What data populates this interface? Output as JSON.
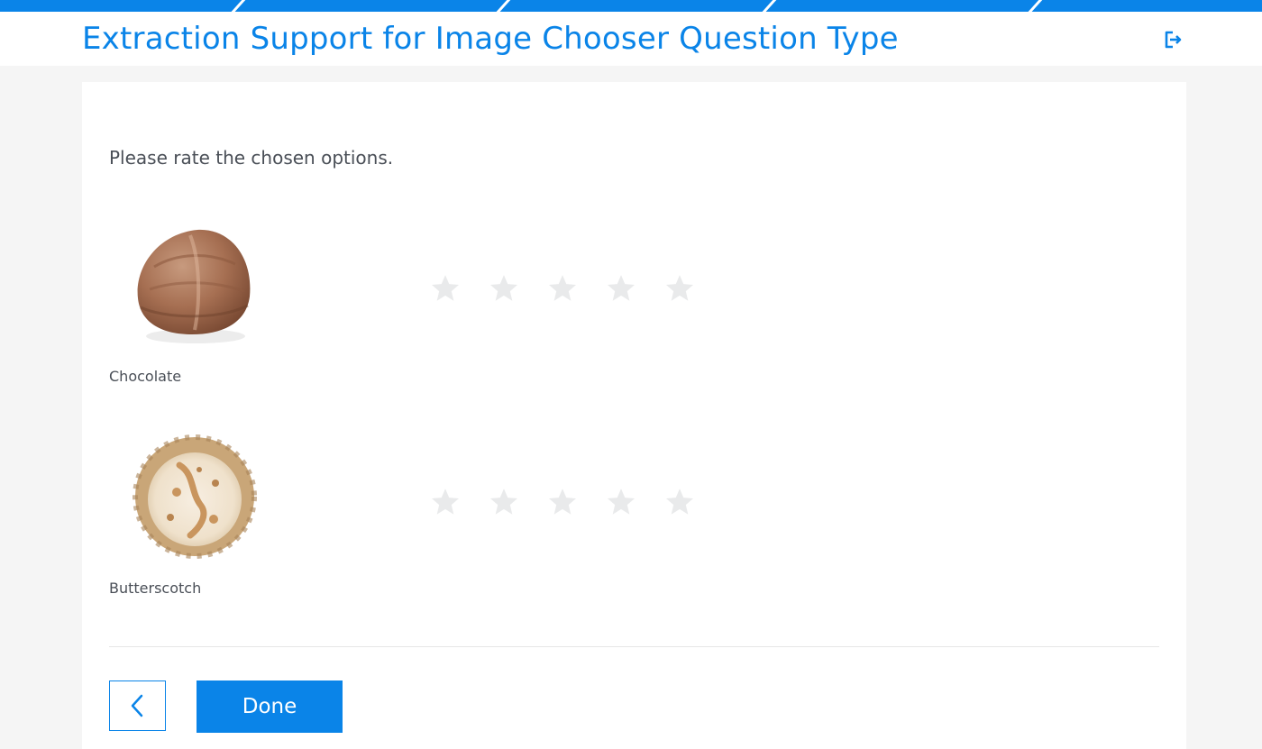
{
  "header": {
    "title": "Extraction Support for Image Chooser Question Type",
    "exit_icon": "logout-icon",
    "accent_color": "#0a84e8"
  },
  "question": {
    "prompt": "Please rate the chosen options."
  },
  "options": [
    {
      "label": "Chocolate",
      "image": "chocolate-ice-cream-scoop",
      "rating": 0,
      "max_rating": 5
    },
    {
      "label": "Butterscotch",
      "image": "butterscotch-ice-cream-scoop",
      "rating": 0,
      "max_rating": 5
    }
  ],
  "navigation": {
    "back_icon": "chevron-left-icon",
    "done_label": "Done"
  }
}
